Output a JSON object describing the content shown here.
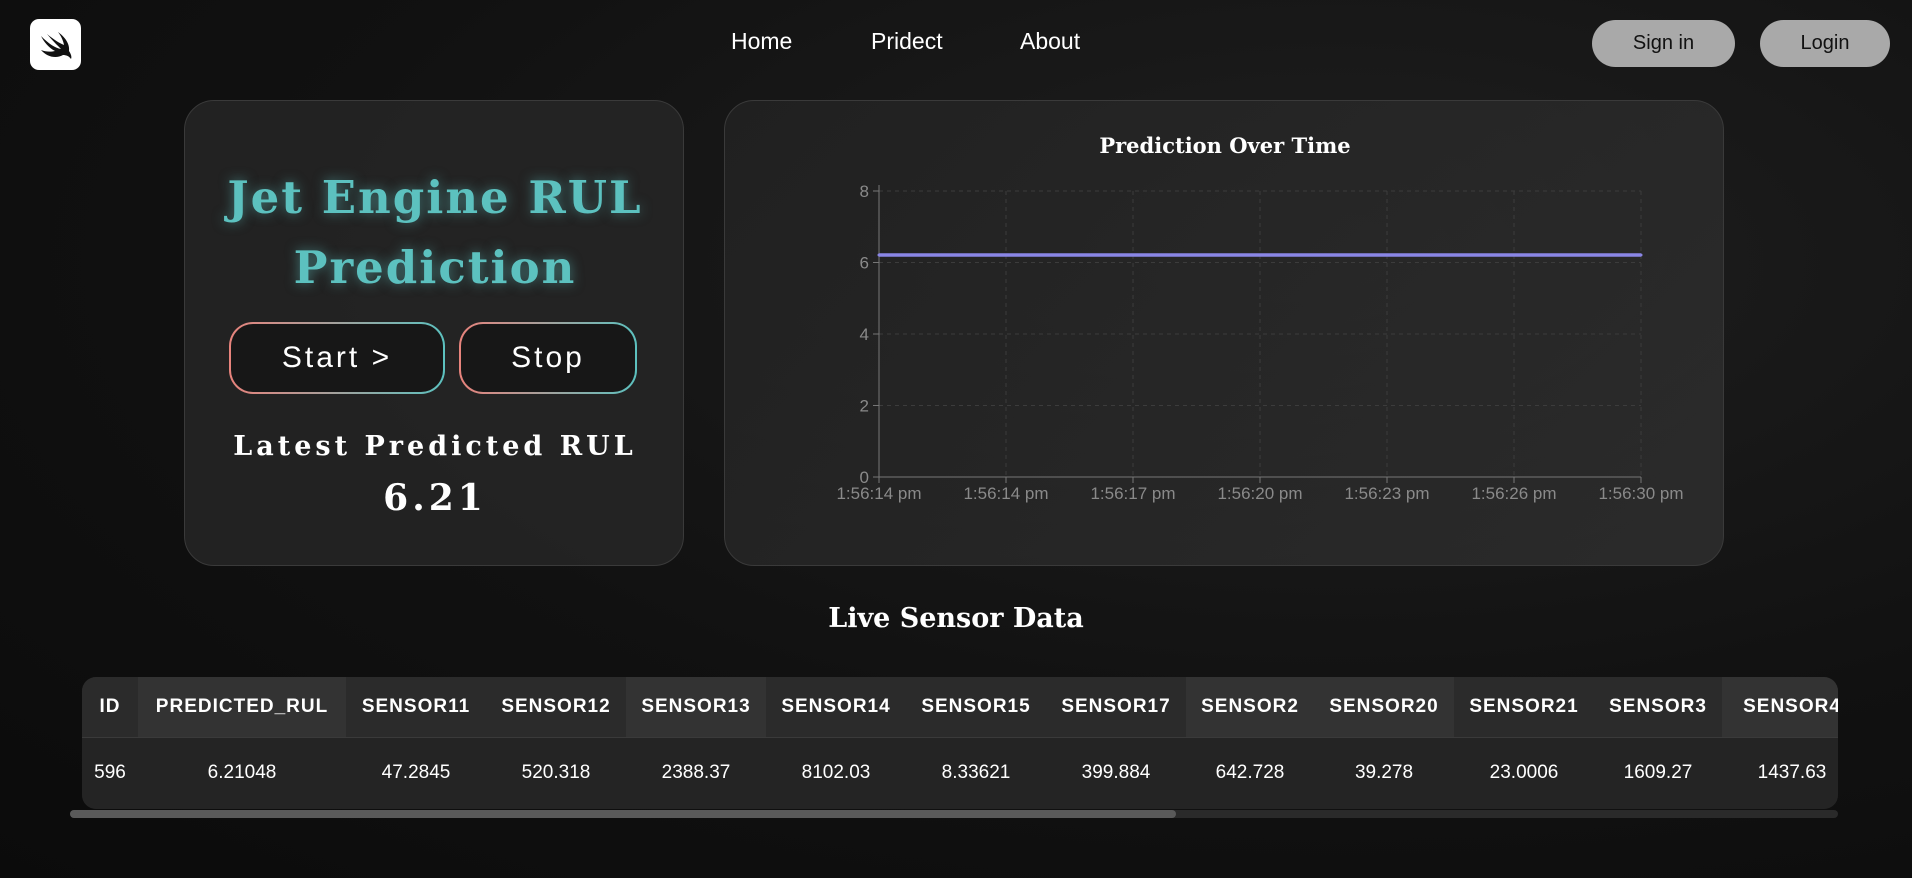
{
  "nav": {
    "logo_icon": "swift-bird-icon",
    "links": [
      "Home",
      "Pridect",
      "About"
    ],
    "signin_label": "Sign in",
    "login_label": "Login"
  },
  "hero": {
    "title_line1": "Jet Engine RUL",
    "title_line2": "Prediction",
    "start_label": "Start >",
    "stop_label": "Stop",
    "latest_label": "Latest Predicted RUL",
    "latest_value": "6.21"
  },
  "chart_data": {
    "type": "line",
    "title": "Prediction Over Time",
    "xlabel": "",
    "ylabel": "",
    "ylim": [
      0,
      8
    ],
    "yticks": [
      0,
      2,
      4,
      6,
      8
    ],
    "x": [
      "1:56:14 pm",
      "1:56:14 pm",
      "1:56:17 pm",
      "1:56:20 pm",
      "1:56:23 pm",
      "1:56:26 pm",
      "1:56:30 pm"
    ],
    "series": [
      {
        "color": "#8a86e6",
        "values": [
          6.21,
          6.21,
          6.21,
          6.21,
          6.21,
          6.21,
          6.21
        ]
      }
    ],
    "grid": true
  },
  "section": {
    "title": "Live Sensor Data"
  },
  "table": {
    "columns": [
      "ID",
      "PREDICTED_RUL",
      "SENSOR11",
      "SENSOR12",
      "SENSOR13",
      "SENSOR14",
      "SENSOR15",
      "SENSOR17",
      "SENSOR2",
      "SENSOR20",
      "SENSOR21",
      "SENSOR3",
      "SENSOR4"
    ],
    "rows": [
      [
        "596",
        "6.21048",
        "47.2845",
        "520.318",
        "2388.37",
        "8102.03",
        "8.33621",
        "399.884",
        "642.728",
        "39.278",
        "23.0006",
        "1609.27",
        "1437.63"
      ]
    ]
  }
}
